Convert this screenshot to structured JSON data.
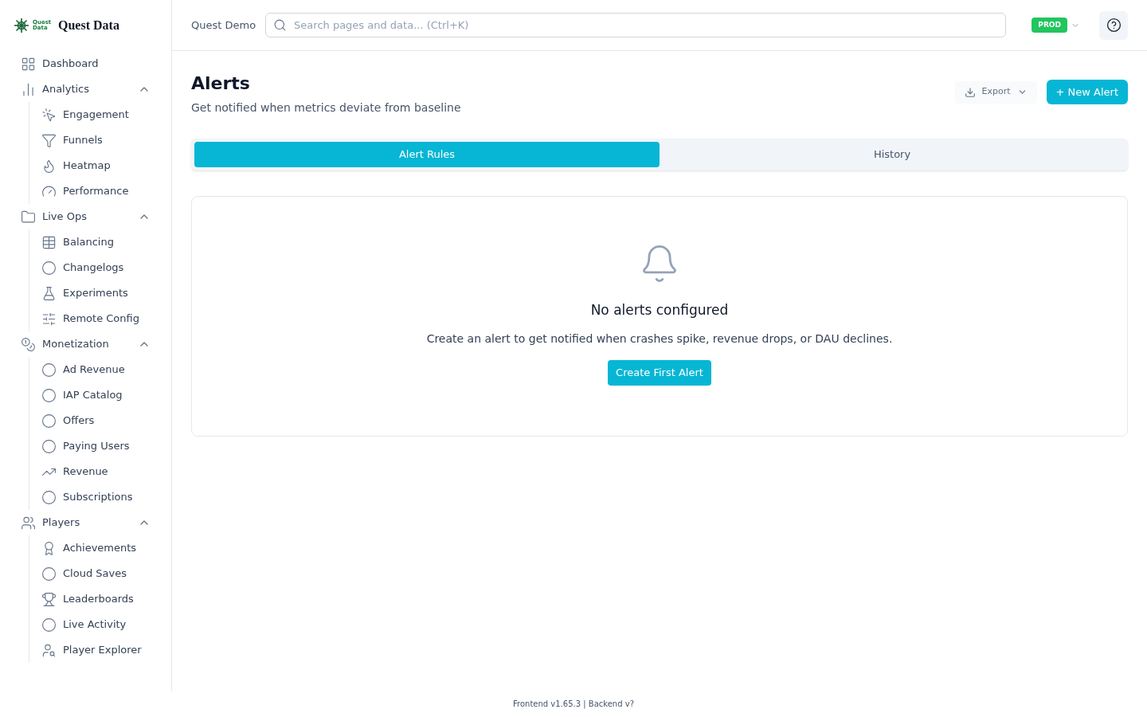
{
  "logo": {
    "mark_text": "Quest Data",
    "name": "Quest Data"
  },
  "sidebar": {
    "items": [
      {
        "label": "Dashboard"
      },
      {
        "label": "Analytics",
        "expanded": true,
        "children": [
          {
            "label": "Engagement"
          },
          {
            "label": "Funnels"
          },
          {
            "label": "Heatmap"
          },
          {
            "label": "Performance"
          }
        ]
      },
      {
        "label": "Live Ops",
        "expanded": true,
        "children": [
          {
            "label": "Balancing"
          },
          {
            "label": "Changelogs"
          },
          {
            "label": "Experiments"
          },
          {
            "label": "Remote Config"
          }
        ]
      },
      {
        "label": "Monetization",
        "expanded": true,
        "children": [
          {
            "label": "Ad Revenue"
          },
          {
            "label": "IAP Catalog"
          },
          {
            "label": "Offers"
          },
          {
            "label": "Paying Users"
          },
          {
            "label": "Revenue"
          },
          {
            "label": "Subscriptions"
          }
        ]
      },
      {
        "label": "Players",
        "expanded": true,
        "children": [
          {
            "label": "Achievements"
          },
          {
            "label": "Cloud Saves"
          },
          {
            "label": "Leaderboards"
          },
          {
            "label": "Live Activity"
          },
          {
            "label": "Player Explorer"
          }
        ]
      }
    ]
  },
  "header": {
    "project": "Quest Demo",
    "search": {
      "placeholder": "Search pages and data... (Ctrl+K)"
    },
    "environment": "PROD"
  },
  "page": {
    "title": "Alerts",
    "subtitle": "Get notified when metrics deviate from baseline",
    "export_button": "Export",
    "new_button": "+ New Alert"
  },
  "tabs": [
    {
      "label": "Alert Rules",
      "selected": true
    },
    {
      "label": "History",
      "selected": false
    }
  ],
  "empty_state": {
    "title": "No alerts configured",
    "message": "Create an alert to get notified when crashes spike, revenue drops, or DAU declines.",
    "button": "Create First Alert"
  },
  "footer": "Frontend v1.65.3 | Backend v?"
}
